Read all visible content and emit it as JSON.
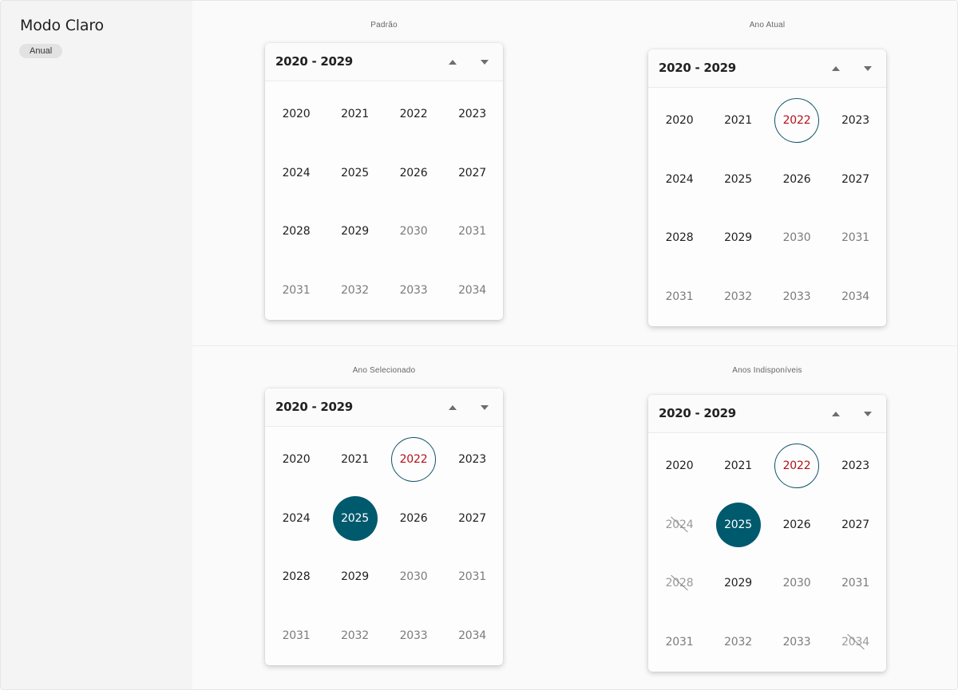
{
  "sidebar": {
    "title": "Modo Claro",
    "badge": "Anual"
  },
  "panels": [
    {
      "label": "Padrão",
      "header": {
        "range": "2020 - 2029"
      },
      "years": [
        {
          "label": "2020",
          "state": "normal"
        },
        {
          "label": "2021",
          "state": "normal"
        },
        {
          "label": "2022",
          "state": "normal"
        },
        {
          "label": "2023",
          "state": "normal"
        },
        {
          "label": "2024",
          "state": "normal"
        },
        {
          "label": "2025",
          "state": "normal"
        },
        {
          "label": "2026",
          "state": "normal"
        },
        {
          "label": "2027",
          "state": "normal"
        },
        {
          "label": "2028",
          "state": "normal"
        },
        {
          "label": "2029",
          "state": "normal"
        },
        {
          "label": "2030",
          "state": "muted"
        },
        {
          "label": "2031",
          "state": "muted"
        },
        {
          "label": "2031",
          "state": "muted"
        },
        {
          "label": "2032",
          "state": "muted"
        },
        {
          "label": "2033",
          "state": "muted"
        },
        {
          "label": "2034",
          "state": "muted"
        }
      ]
    },
    {
      "label": "Ano Atual",
      "header": {
        "range": "2020 - 2029"
      },
      "years": [
        {
          "label": "2020",
          "state": "normal"
        },
        {
          "label": "2021",
          "state": "normal"
        },
        {
          "label": "2022",
          "state": "current"
        },
        {
          "label": "2023",
          "state": "normal"
        },
        {
          "label": "2024",
          "state": "normal"
        },
        {
          "label": "2025",
          "state": "normal"
        },
        {
          "label": "2026",
          "state": "normal"
        },
        {
          "label": "2027",
          "state": "normal"
        },
        {
          "label": "2028",
          "state": "normal"
        },
        {
          "label": "2029",
          "state": "normal"
        },
        {
          "label": "2030",
          "state": "muted"
        },
        {
          "label": "2031",
          "state": "muted"
        },
        {
          "label": "2031",
          "state": "muted"
        },
        {
          "label": "2032",
          "state": "muted"
        },
        {
          "label": "2033",
          "state": "muted"
        },
        {
          "label": "2034",
          "state": "muted"
        }
      ]
    },
    {
      "label": "Ano Selecionado",
      "header": {
        "range": "2020 - 2029"
      },
      "years": [
        {
          "label": "2020",
          "state": "normal"
        },
        {
          "label": "2021",
          "state": "normal"
        },
        {
          "label": "2022",
          "state": "current"
        },
        {
          "label": "2023",
          "state": "normal"
        },
        {
          "label": "2024",
          "state": "normal"
        },
        {
          "label": "2025",
          "state": "selected"
        },
        {
          "label": "2026",
          "state": "normal"
        },
        {
          "label": "2027",
          "state": "normal"
        },
        {
          "label": "2028",
          "state": "normal"
        },
        {
          "label": "2029",
          "state": "normal"
        },
        {
          "label": "2030",
          "state": "muted"
        },
        {
          "label": "2031",
          "state": "muted"
        },
        {
          "label": "2031",
          "state": "muted"
        },
        {
          "label": "2032",
          "state": "muted"
        },
        {
          "label": "2033",
          "state": "muted"
        },
        {
          "label": "2034",
          "state": "muted"
        }
      ]
    },
    {
      "label": "Anos Indisponíveis",
      "header": {
        "range": "2020 - 2029"
      },
      "years": [
        {
          "label": "2020",
          "state": "normal"
        },
        {
          "label": "2021",
          "state": "normal"
        },
        {
          "label": "2022",
          "state": "current"
        },
        {
          "label": "2023",
          "state": "normal"
        },
        {
          "label": "2024",
          "state": "disabled"
        },
        {
          "label": "2025",
          "state": "selected"
        },
        {
          "label": "2026",
          "state": "normal"
        },
        {
          "label": "2027",
          "state": "normal"
        },
        {
          "label": "2028",
          "state": "disabled"
        },
        {
          "label": "2029",
          "state": "normal"
        },
        {
          "label": "2030",
          "state": "muted"
        },
        {
          "label": "2031",
          "state": "muted"
        },
        {
          "label": "2031",
          "state": "muted"
        },
        {
          "label": "2032",
          "state": "muted"
        },
        {
          "label": "2033",
          "state": "muted"
        },
        {
          "label": "2034",
          "state": "disabled"
        }
      ]
    }
  ],
  "icons": {
    "nav_up": "triangle-up-icon",
    "nav_down": "triangle-down-icon"
  },
  "colors": {
    "accent": "#005a6e",
    "current_ring": "#0e5568",
    "current_text": "#b3111b"
  }
}
